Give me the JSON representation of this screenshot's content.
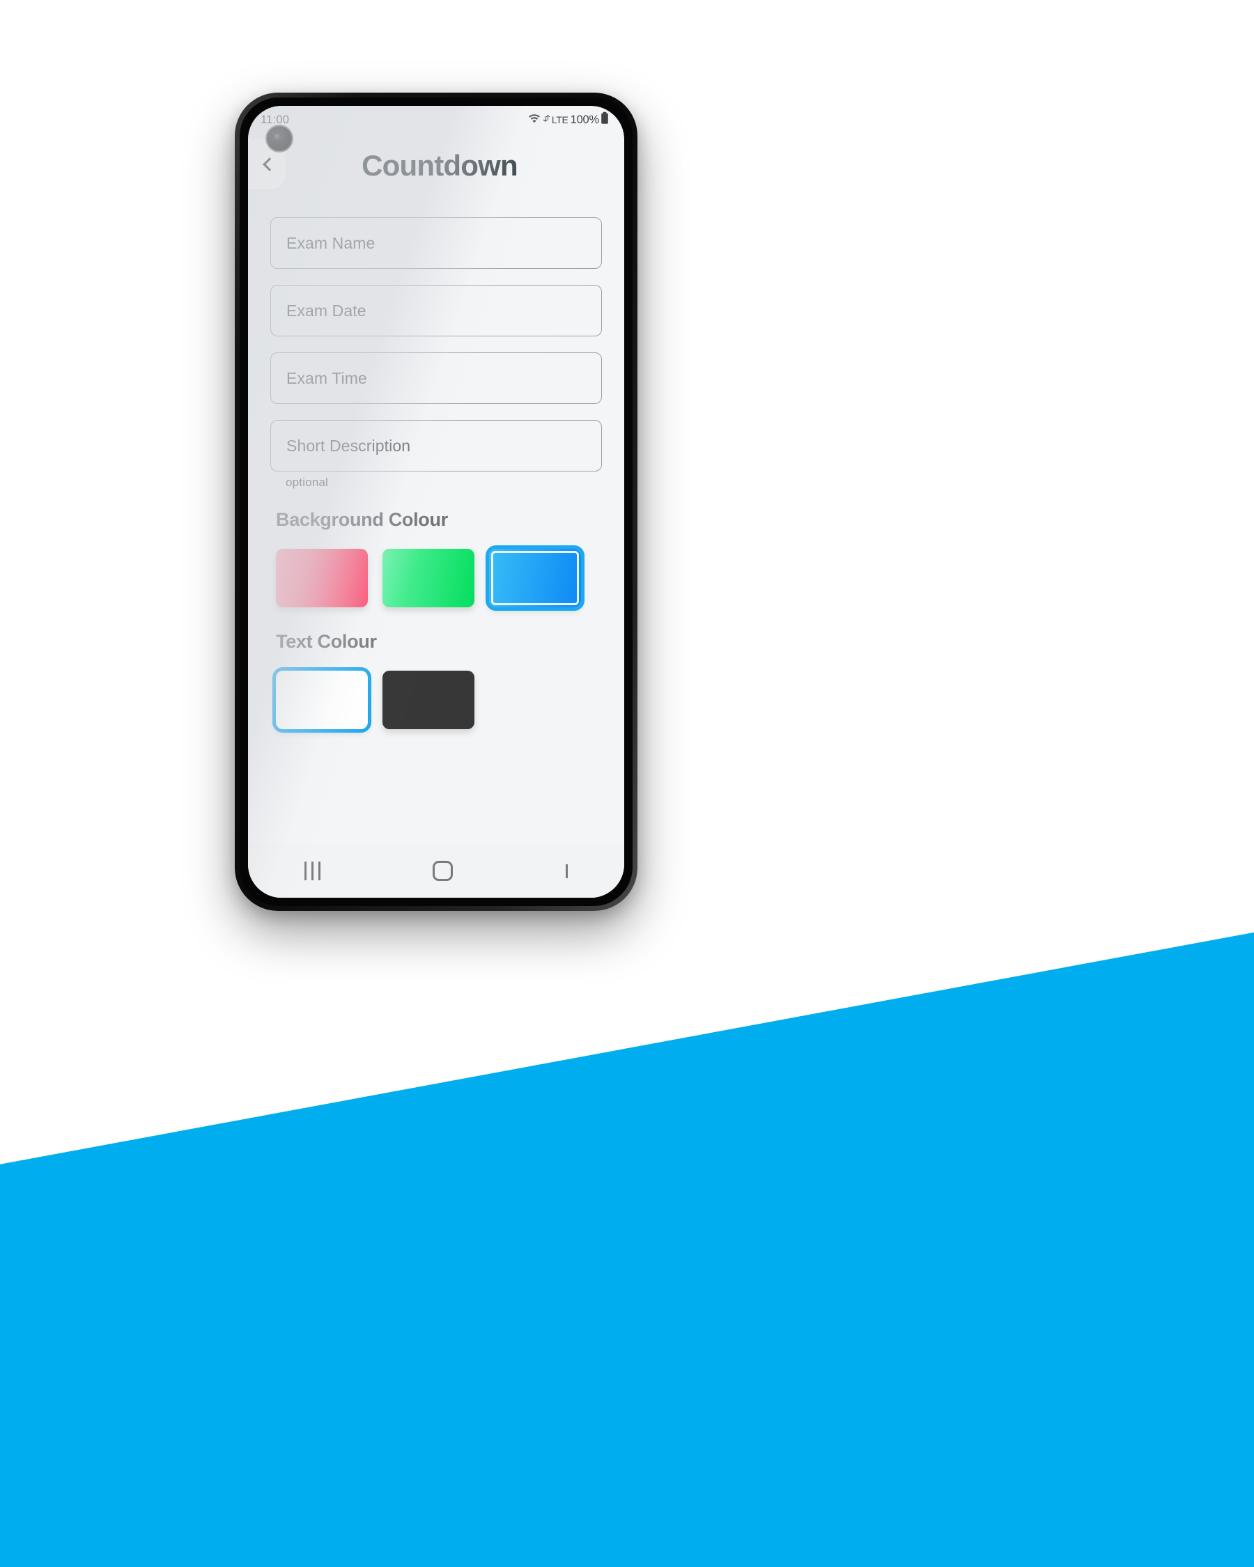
{
  "background": {
    "top_colour": "#ffffff",
    "bottom_colour": "#00AEEF"
  },
  "status_bar": {
    "time": "11:00",
    "wifi_icon": "wifi-icon",
    "network_label": "LTE",
    "battery_percent": "100%",
    "battery_icon": "battery-full-icon"
  },
  "header": {
    "back_icon": "chevron-left-icon",
    "title": "Countdown"
  },
  "form": {
    "fields": [
      {
        "name": "exam-name",
        "placeholder": "Exam Name",
        "value": ""
      },
      {
        "name": "exam-date",
        "placeholder": "Exam Date",
        "value": ""
      },
      {
        "name": "exam-time",
        "placeholder": "Exam Time",
        "value": ""
      },
      {
        "name": "short-description",
        "placeholder": "Short Description",
        "value": ""
      }
    ],
    "optional_label": "optional"
  },
  "background_colour_section": {
    "heading": "Background Colour",
    "swatches": [
      {
        "name": "pink",
        "from": "#FBA8B9",
        "to": "#FC3E64",
        "selected": false
      },
      {
        "name": "green",
        "from": "#5CF2A2",
        "to": "#00DE5C",
        "selected": false
      },
      {
        "name": "blue",
        "from": "#35BDF6",
        "to": "#0B87F5",
        "selected": true
      }
    ],
    "selected": "blue",
    "selection_colour": "#1BA7F0"
  },
  "text_colour_section": {
    "heading": "Text Colour",
    "swatches": [
      {
        "name": "white",
        "from": "#ffffff",
        "to": "#ffffff",
        "selected": true
      },
      {
        "name": "dark",
        "from": "#343434",
        "to": "#343434",
        "selected": false
      }
    ],
    "selected": "white",
    "selection_colour": "#1BA7F0"
  },
  "nav_bar": {
    "recents_icon": "recents-icon",
    "home_icon": "home-square-icon",
    "back_icon": "chevron-left-icon"
  }
}
